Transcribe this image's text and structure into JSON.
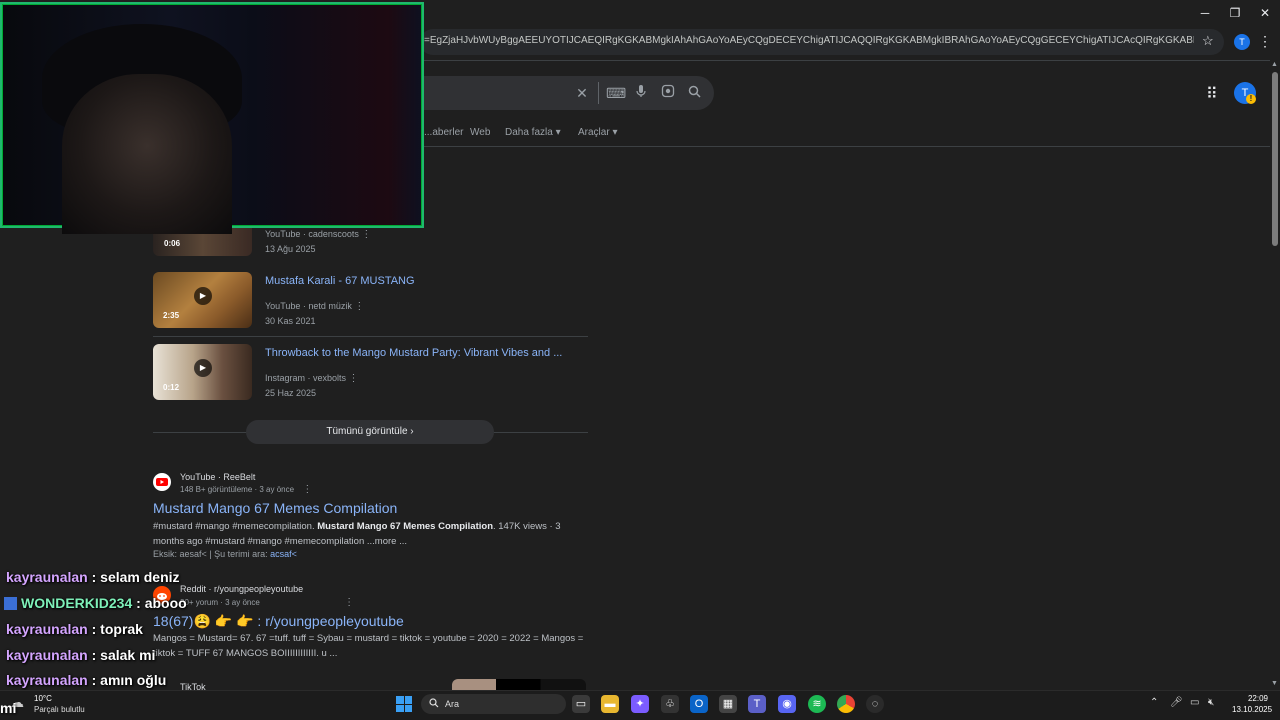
{
  "browser": {
    "url": "=EgZjaHJvbWUyBggAEEUYOTIJCAEQIRgKGKABMgkIAhAhGAoYoAEyCQgDECEYChigATIJCAQQIRgKGKABMgkIBRAhGAoYoAEyCQgGECEYChigATIJCAcQIRgKGKABMgkICBAhGAoYoAHSAQk3NjM0ajBqMTWoAgmwAgHxBR4SBREY7hcl&sourceid...",
    "profile_initial": "T"
  },
  "google": {
    "tabs": [
      "...aberler",
      "Web",
      "Daha fazla",
      "Araçlar"
    ],
    "avatar_initial": "T",
    "avatar_badge": "!"
  },
  "video_results": [
    {
      "duration": "0:06",
      "title": "",
      "source": "YouTube · cadenscoots",
      "date": "13 Ağu 2025"
    },
    {
      "duration": "2:35",
      "title": "Mustafa Karali - 67 MUSTANG",
      "source": "YouTube · netd müzik",
      "date": "30 Kas 2021"
    },
    {
      "duration": "0:12",
      "title": "Throwback to the Mango Mustard Party: Vibrant Vibes and ...",
      "source": "Instagram · vexbolts",
      "date": "25 Haz 2025"
    }
  ],
  "view_all_label": "Tümünü görüntüle",
  "web_results": [
    {
      "site": "YouTube · ReeBelt",
      "meta": "148 B+ görüntüleme · 3 ay önce",
      "title": "Mustard Mango 67 Memes Compilation",
      "snippet_pre": "#mustard #mango #memecompilation. ",
      "snippet_bold": "Mustard Mango 67 Memes Compilation",
      "snippet_post": ". 147K views · 3 months ago #mustard #mango #memecompilation ...more ...",
      "missing_label": "Eksik: aesaf< | Şu terimi ara:",
      "missing_link": "acsaf<"
    },
    {
      "site": "Reddit · r/youngpeopleyoutube",
      "meta": "30+ yorum · 3 ay önce",
      "title": "18(67)😩 👉 👉 : r/youngpeopleyoutube",
      "snippet": "Mangos = Mustard= 67. 67 =tuff. tuff = Sybau = mustard = tiktok = youtube = 2020 = 2022 = Mangos = tiktok = TUFF 67 MANGOS BOIIIIIIIIIIII. u ..."
    },
    {
      "site": "TikTok"
    }
  ],
  "chat": [
    {
      "user": "kayraunalan",
      "message": "selam deniz",
      "badge": false
    },
    {
      "user": "WONDERKID234",
      "message": "abooo",
      "badge": true
    },
    {
      "user": "kayraunalan",
      "message": "toprak",
      "badge": false
    },
    {
      "user": "kayraunalan",
      "message": "salak mi",
      "badge": false
    },
    {
      "user": "kayraunalan",
      "message": "amın oğlu",
      "badge": false
    }
  ],
  "overlay_fragment": "mi",
  "taskbar": {
    "temp": "10°C",
    "weather": "Parçalı bulutlu",
    "search_placeholder": "Ara",
    "time": "22:09",
    "date": "13.10.2025"
  },
  "colors": {
    "link": "#8ab4f8",
    "webcam_border": "#1fb86e",
    "chat_user": "#d4a5ff",
    "chat_user_alt": "#7ef0b9"
  }
}
